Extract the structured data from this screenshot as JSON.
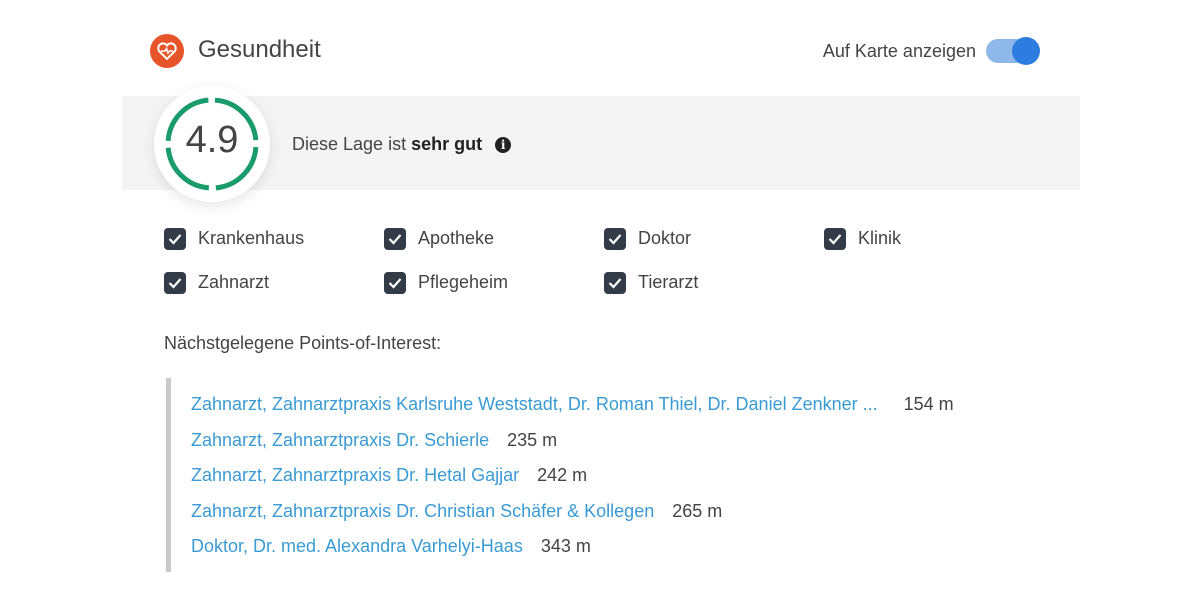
{
  "header": {
    "icon": "heart-pulse-icon",
    "title": "Gesundheit",
    "map_toggle_label": "Auf Karte anzeigen",
    "map_toggle_on": true,
    "accent_color": "#e8542a"
  },
  "rating": {
    "score": "4.9",
    "text_prefix": "Diese Lage ist",
    "text_emphasis": "sehr gut",
    "info_icon": "info-icon",
    "ring_color": "#1a9b6b"
  },
  "filters": [
    {
      "label": "Krankenhaus",
      "checked": true
    },
    {
      "label": "Apotheke",
      "checked": true
    },
    {
      "label": "Doktor",
      "checked": true
    },
    {
      "label": "Klinik",
      "checked": true
    },
    {
      "label": "Zahnarzt",
      "checked": true
    },
    {
      "label": "Pflegeheim",
      "checked": true
    },
    {
      "label": "Tierarzt",
      "checked": true
    }
  ],
  "poi": {
    "heading": "Nächstgelegene Points-of-Interest:",
    "link_color": "#3a9bd4",
    "items": [
      {
        "name": "Zahnarzt, Zahnarztpraxis Karlsruhe Weststadt, Dr. Roman Thiel, Dr. Daniel Zenkner ...",
        "distance": "154 m"
      },
      {
        "name": "Zahnarzt, Zahnarztpraxis Dr. Schierle",
        "distance": "235 m"
      },
      {
        "name": "Zahnarzt, Zahnarztpraxis Dr. Hetal Gajjar",
        "distance": "242 m"
      },
      {
        "name": "Zahnarzt, Zahnarztpraxis Dr. Christian Schäfer & Kollegen",
        "distance": "265 m"
      },
      {
        "name": "Doktor, Dr. med. Alexandra Varhelyi-Haas",
        "distance": "343 m"
      }
    ]
  }
}
